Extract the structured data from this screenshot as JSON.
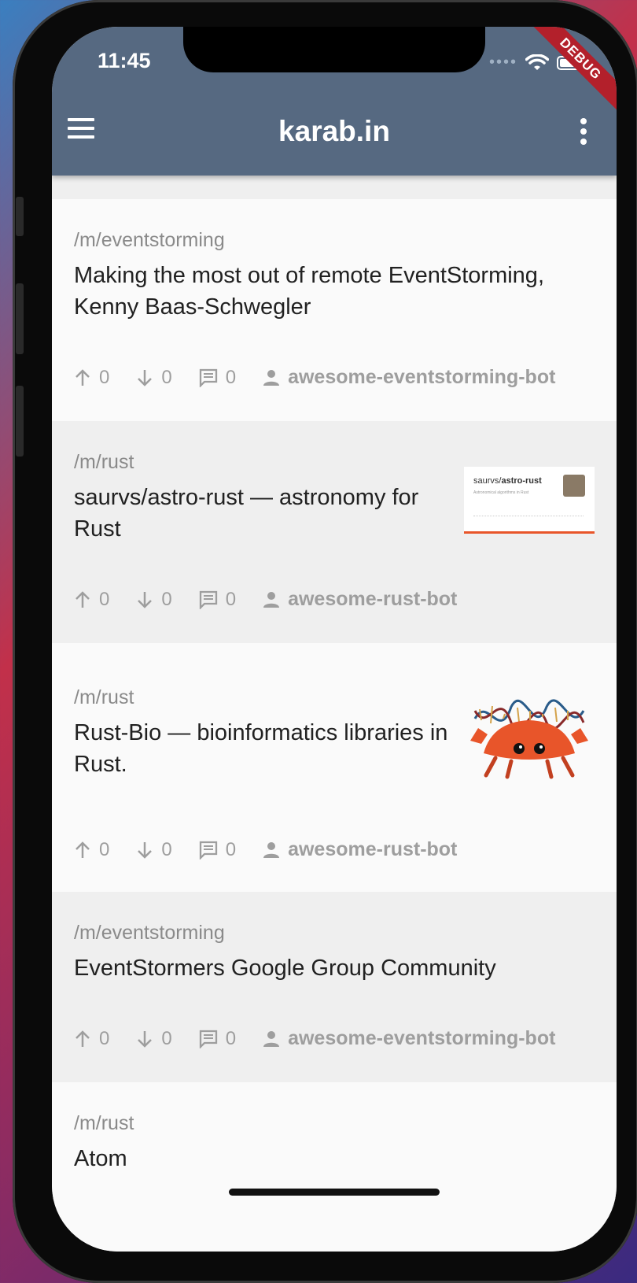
{
  "status": {
    "time": "11:45",
    "debug_label": "DEBUG"
  },
  "appbar": {
    "title": "karab.in"
  },
  "posts": [
    {
      "community": "/m/eventstorming",
      "title": "Making the most out of remote EventStorming, Kenny Baas-Schwegler",
      "upvotes": "0",
      "downvotes": "0",
      "comments": "0",
      "author": "awesome-eventstorming-bot"
    },
    {
      "community": "/m/rust",
      "title": "saurvs/astro-rust — astronomy for Rust",
      "upvotes": "0",
      "downvotes": "0",
      "comments": "0",
      "author": "awesome-rust-bot",
      "thumbnail": {
        "repo_owner": "saurvs/",
        "repo_name": "astro-rust",
        "description": "Astronomical algorithms in Rust"
      }
    },
    {
      "community": "/m/rust",
      "title": "Rust-Bio — bioinformatics libraries in Rust.",
      "upvotes": "0",
      "downvotes": "0",
      "comments": "0",
      "author": "awesome-rust-bot",
      "thumbnail_icon": "ferris-crab-dna-icon"
    },
    {
      "community": "/m/eventstorming",
      "title": "EventStormers Google Group Community",
      "upvotes": "0",
      "downvotes": "0",
      "comments": "0",
      "author": "awesome-eventstorming-bot"
    },
    {
      "community": "/m/rust",
      "title": "Atom"
    }
  ],
  "colors": {
    "appbar": "#566981",
    "accent_orange": "#e8552a"
  }
}
